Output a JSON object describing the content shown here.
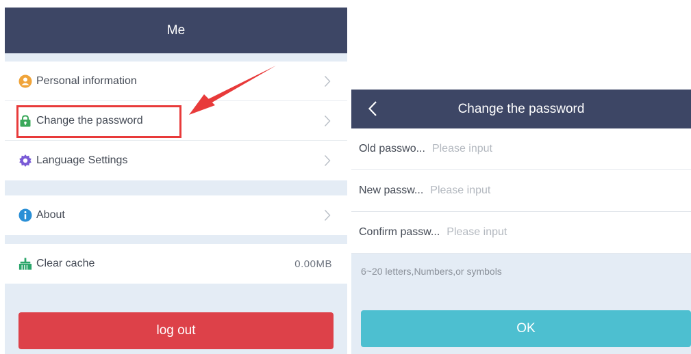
{
  "me_screen": {
    "title": "Me",
    "group1": [
      {
        "label": "Personal information",
        "icon": "person-icon"
      },
      {
        "label": "Change the password",
        "icon": "lock-icon"
      },
      {
        "label": "Language Settings",
        "icon": "gear-icon"
      }
    ],
    "about": {
      "label": "About",
      "icon": "info-icon"
    },
    "clear_cache": {
      "label": "Clear cache",
      "value": "0.00MB",
      "icon": "broom-icon"
    },
    "logout_label": "log out"
  },
  "password_screen": {
    "title": "Change the password",
    "fields": [
      {
        "label": "Old passwo...",
        "placeholder": "Please input"
      },
      {
        "label": "New passw...",
        "placeholder": "Please input"
      },
      {
        "label": "Confirm passw...",
        "placeholder": "Please input"
      }
    ],
    "hint": "6~20 letters,Numbers,or symbols",
    "ok_label": "OK"
  },
  "colors": {
    "header": "#3d4665",
    "background": "#e4ecf5",
    "logout": "#dd4149",
    "ok": "#4dbfd0",
    "highlight": "#e83a3a",
    "person_icon": "#f0a43a",
    "lock_icon": "#3aa85a",
    "gear_icon": "#7a5bd6",
    "info_icon": "#2a8fd6",
    "broom_icon": "#2aa56a"
  }
}
